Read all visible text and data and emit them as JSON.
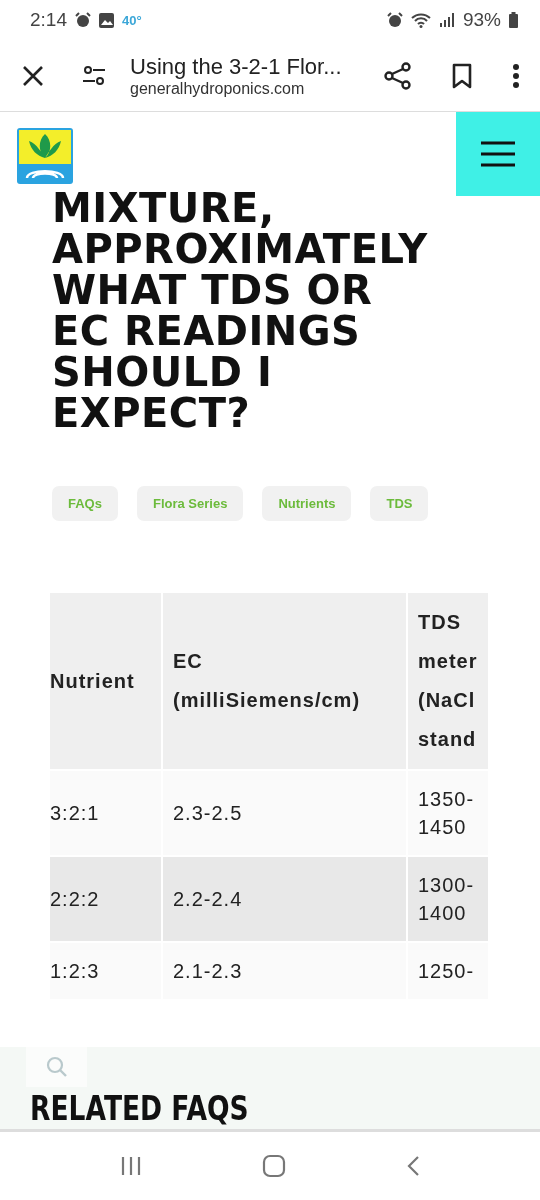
{
  "status_bar": {
    "time": "2:14",
    "temperature": "40°",
    "battery": "93%"
  },
  "browser_bar": {
    "page_title": "Using the 3-2-1 Flor...",
    "domain": "generalhydroponics.com"
  },
  "article": {
    "heading": [
      "MIXTURE,",
      "APPROXIMATELY",
      "WHAT TDS OR",
      "EC READINGS",
      "SHOULD I",
      "EXPECT?"
    ],
    "tags": [
      "FAQs",
      "Flora Series",
      "Nutrients",
      "TDS"
    ]
  },
  "table": {
    "columns": [
      "Nutrient",
      "EC (milliSiemens/cm)",
      "TDS meter (NaCl stand"
    ],
    "rows": [
      [
        "3:2:1",
        "2.3-2.5",
        "1350-1450"
      ],
      [
        "2:2:2",
        "2.2-2.4",
        "1300-1400"
      ],
      [
        "1:2:3",
        "2.1-2.3",
        "1250-"
      ]
    ]
  },
  "related": {
    "heading": "RELATED FAQS"
  }
}
